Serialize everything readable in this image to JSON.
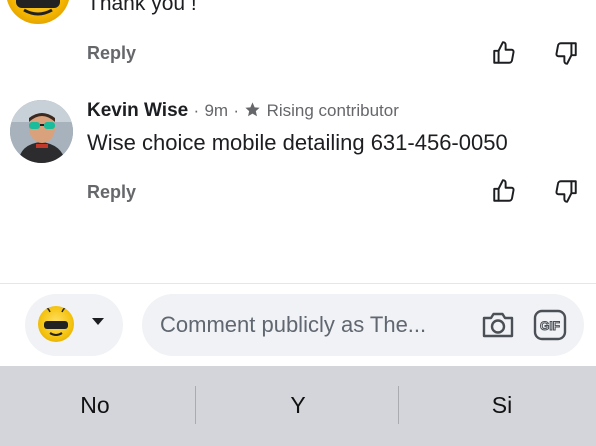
{
  "previous_comment": {
    "text": "Thank you !",
    "reply_label": "Reply"
  },
  "comment": {
    "author": "Kevin Wise",
    "separator1": "·",
    "time": "9m",
    "separator2": "·",
    "badge_icon": "star-icon",
    "badge": "Rising contributor",
    "text": "Wise choice mobile detailing 631-456-0050",
    "reply_label": "Reply"
  },
  "composer": {
    "placeholder": "Comment publicly as The..."
  },
  "keyboard": {
    "suggestions": [
      "No",
      "Y",
      "Si"
    ]
  },
  "icons": {
    "like": "thumbs-up-icon",
    "dislike": "thumbs-down-icon",
    "camera": "camera-icon",
    "gif": "gif-icon"
  }
}
